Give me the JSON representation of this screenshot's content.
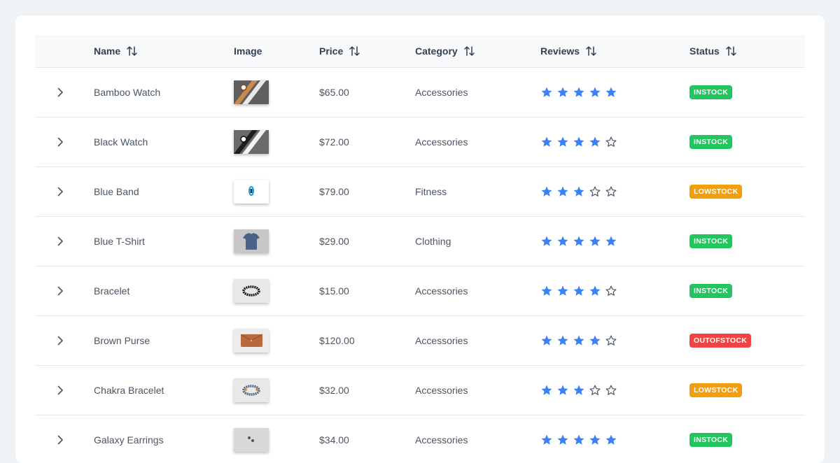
{
  "table": {
    "columns": [
      {
        "key": "name",
        "label": "Name",
        "sortable": true
      },
      {
        "key": "image",
        "label": "Image",
        "sortable": false
      },
      {
        "key": "price",
        "label": "Price",
        "sortable": true
      },
      {
        "key": "category",
        "label": "Category",
        "sortable": true
      },
      {
        "key": "reviews",
        "label": "Reviews",
        "sortable": true
      },
      {
        "key": "status",
        "label": "Status",
        "sortable": true
      }
    ],
    "rows": [
      {
        "name": "Bamboo Watch",
        "image": "bamboo-watch-thumbnail",
        "price": "$65.00",
        "category": "Accessories",
        "rating": 5,
        "status": "INSTOCK"
      },
      {
        "name": "Black Watch",
        "image": "black-watch-thumbnail",
        "price": "$72.00",
        "category": "Accessories",
        "rating": 4,
        "status": "INSTOCK"
      },
      {
        "name": "Blue Band",
        "image": "blue-band-thumbnail",
        "price": "$79.00",
        "category": "Fitness",
        "rating": 3,
        "status": "LOWSTOCK"
      },
      {
        "name": "Blue T-Shirt",
        "image": "blue-tshirt-thumbnail",
        "price": "$29.00",
        "category": "Clothing",
        "rating": 5,
        "status": "INSTOCK"
      },
      {
        "name": "Bracelet",
        "image": "bracelet-thumbnail",
        "price": "$15.00",
        "category": "Accessories",
        "rating": 4,
        "status": "INSTOCK"
      },
      {
        "name": "Brown Purse",
        "image": "brown-purse-thumbnail",
        "price": "$120.00",
        "category": "Accessories",
        "rating": 4,
        "status": "OUTOFSTOCK"
      },
      {
        "name": "Chakra Bracelet",
        "image": "chakra-bracelet-thumbnail",
        "price": "$32.00",
        "category": "Accessories",
        "rating": 3,
        "status": "LOWSTOCK"
      },
      {
        "name": "Galaxy Earrings",
        "image": "galaxy-earrings-thumbnail",
        "price": "$34.00",
        "category": "Accessories",
        "rating": 5,
        "status": "INSTOCK"
      }
    ]
  },
  "icons": {
    "expand": "chevron-right-icon",
    "sort": "sort-arrows-icon",
    "star_filled": "star-filled-icon",
    "star_empty": "star-outline-icon"
  },
  "colors": {
    "star": "#3b82f6",
    "instock": "#22c55e",
    "lowstock": "#f59e0b",
    "outofstock": "#ef4444"
  }
}
